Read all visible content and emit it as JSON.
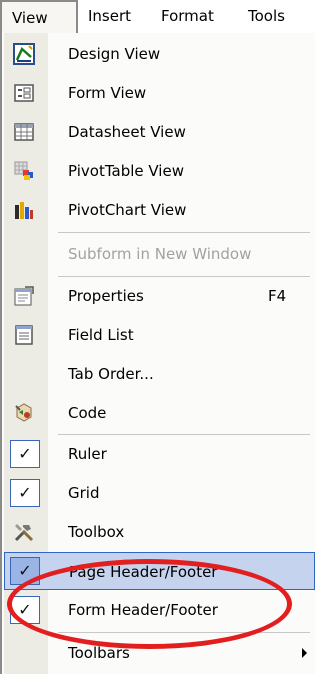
{
  "menubar": {
    "view": "View",
    "insert": "Insert",
    "format": "Format",
    "tools": "Tools"
  },
  "menu": {
    "design_view": {
      "label": "Design View",
      "icon": "design-view-icon"
    },
    "form_view": {
      "label": "Form View",
      "icon": "form-view-icon"
    },
    "datasheet_view": {
      "label": "Datasheet View",
      "icon": "datasheet-view-icon"
    },
    "pivottable_view": {
      "label": "PivotTable View",
      "icon": "pivottable-view-icon"
    },
    "pivotchart_view": {
      "label": "PivotChart View",
      "icon": "pivotchart-view-icon"
    },
    "subform_new_window": {
      "label": "Subform in New Window",
      "enabled": false
    },
    "properties": {
      "label": "Properties",
      "shortcut": "F4",
      "icon": "properties-icon"
    },
    "field_list": {
      "label": "Field List",
      "icon": "field-list-icon"
    },
    "tab_order": {
      "label": "Tab Order..."
    },
    "code": {
      "label": "Code",
      "icon": "code-icon"
    },
    "ruler": {
      "label": "Ruler",
      "checked": true
    },
    "grid": {
      "label": "Grid",
      "checked": true
    },
    "toolbox": {
      "label": "Toolbox",
      "icon": "toolbox-icon"
    },
    "page_header_footer": {
      "label": "Page Header/Footer",
      "checked": true,
      "highlighted": true
    },
    "form_header_footer": {
      "label": "Form Header/Footer",
      "checked": true
    },
    "toolbars": {
      "label": "Toolbars",
      "submenu": true
    }
  },
  "check_glyph": "✓",
  "colors": {
    "highlight_fill": "#c5d3ee",
    "highlight_border": "#3165c5",
    "annotation_ellipse": "#e31e1e",
    "disabled_text": "#a2a2a2"
  }
}
